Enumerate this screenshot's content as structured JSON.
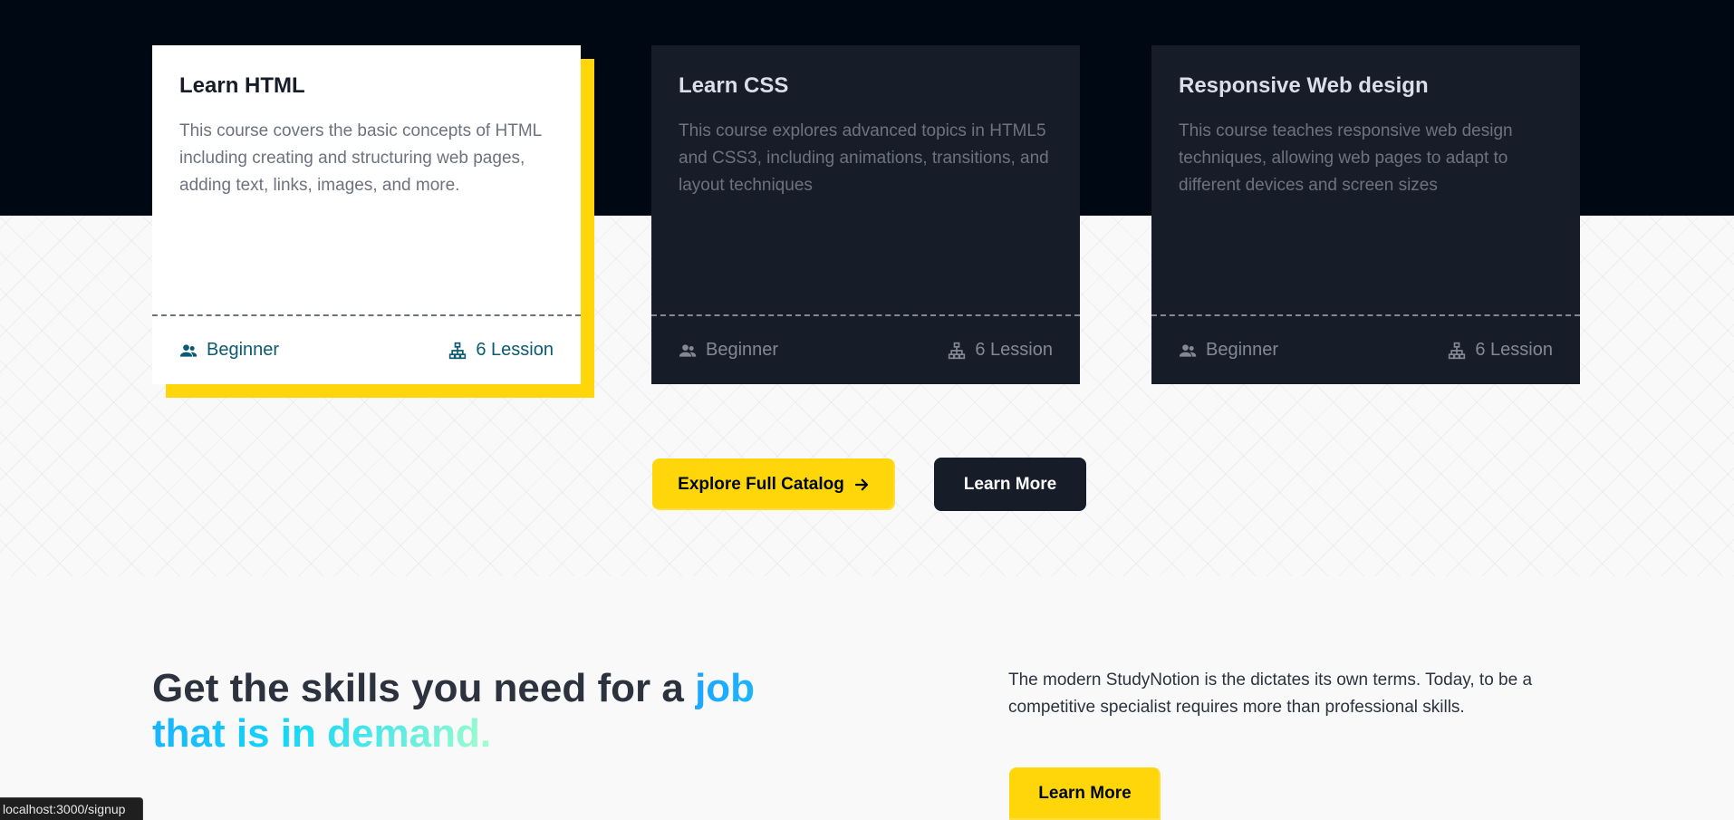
{
  "cards": [
    {
      "title": "Learn HTML",
      "description": "This course covers the basic concepts of HTML including creating and structuring web pages, adding text, links, images, and more.",
      "level": "Beginner",
      "lessons": "6 Lession",
      "icons": {
        "level": "users-icon",
        "lessons": "hierarchy-icon"
      }
    },
    {
      "title": "Learn CSS",
      "description": "This course explores advanced topics in HTML5 and CSS3, including animations, transitions, and layout techniques",
      "level": "Beginner",
      "lessons": "6 Lession",
      "icons": {
        "level": "users-icon",
        "lessons": "hierarchy-icon"
      }
    },
    {
      "title": "Responsive Web design",
      "description": "This course teaches responsive web design techniques, allowing web pages to adapt to different devices and screen sizes",
      "level": "Beginner",
      "lessons": "6 Lession",
      "icons": {
        "level": "users-icon",
        "lessons": "hierarchy-icon"
      }
    }
  ],
  "buttons": {
    "explore_catalog": "Explore Full Catalog",
    "explore_icon": "arrow-right-icon",
    "learn_more_dark": "Learn More",
    "learn_more_yellow": "Learn More"
  },
  "skills_section": {
    "heading_plain": "Get the skills you need for a ",
    "heading_highlight": "job that is in demand.",
    "description": "The modern StudyNotion is the dictates its own terms. Today, to be a competitive specialist requires more than professional skills."
  },
  "status_bar": {
    "url": "localhost:3000/signup"
  },
  "colors": {
    "dark_bg": "#000814",
    "card_dark": "#161d29",
    "accent_yellow": "#ffd60a",
    "active_footer": "#0a5a72",
    "highlight_gradient_start": "#1fa2ff",
    "highlight_gradient_end": "#12d8fa"
  }
}
